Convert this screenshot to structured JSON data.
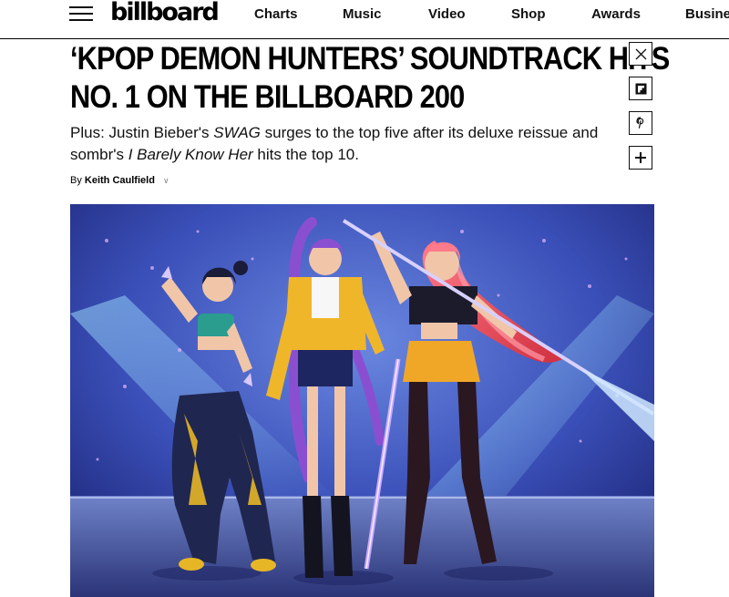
{
  "site": {
    "logo": "billboard"
  },
  "nav": {
    "items": [
      {
        "label": "Charts"
      },
      {
        "label": "Music"
      },
      {
        "label": "Video"
      },
      {
        "label": "Shop"
      },
      {
        "label": "Awards"
      },
      {
        "label": "Busines"
      }
    ]
  },
  "article": {
    "headline_line1": "‘KPOP DEMON HUNTERS’ SOUNDTRACK HITS",
    "headline_line2": "NO. 1 ON THE BILLBOARD 200",
    "dek": {
      "part1": "Plus: Justin Bieber's ",
      "italic1": "SWAG",
      "part2": " surges to the top five after its deluxe reissue and sombr's ",
      "italic2": "I Barely Know Her",
      "part3": " hits the top 10."
    },
    "byline_prefix": "By",
    "author": "Keith Caulfield"
  },
  "share": {
    "icons": [
      "x-icon",
      "flipboard-icon",
      "pinterest-icon",
      "plus-icon"
    ]
  },
  "colors": {
    "accent_blue": "#1f3fa8",
    "text": "#000000"
  }
}
